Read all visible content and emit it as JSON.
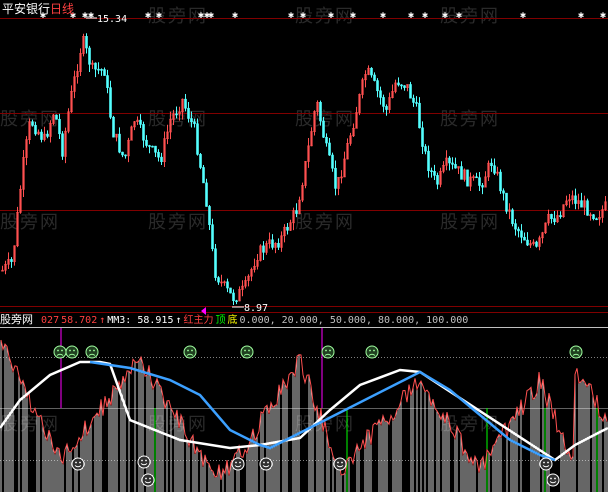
{
  "window": {
    "stock_name": "平安银行",
    "period_label": "日线"
  },
  "price_panel": {
    "high_label": "15.34",
    "low_label": "8.97"
  },
  "indicator_panel": {
    "name": "股旁网",
    "values": [
      {
        "key": "v1",
        "text": "027",
        "color": "#ff4040"
      },
      {
        "key": "v2",
        "text": "58.702",
        "color": "#ff4040"
      },
      {
        "key": "v2_arrow",
        "text": "↑",
        "color": "#ff4040"
      },
      {
        "key": "mm3",
        "text": "MM3: 58.915",
        "color": "#ffffff"
      },
      {
        "key": "mm3_arrow",
        "text": "↑",
        "color": "#ffffff"
      },
      {
        "key": "main",
        "text": "红主力",
        "color": "#ff4040"
      },
      {
        "key": "top",
        "text": "顶",
        "color": "#00ff00"
      },
      {
        "key": "bottom",
        "text": "底",
        "color": "#ffff00"
      },
      {
        "key": "levels",
        "text": "0.000, 20.000, 50.000, 80.000, 100.000",
        "color": "#c0c0c0"
      }
    ]
  },
  "watermark": "股旁网",
  "colors": {
    "up": "#ff5050",
    "down": "#54ffff",
    "grid": "#800000",
    "ma_white": "#ffffff",
    "ma_blue": "#3ca0ff",
    "signal_green": "#00ff00",
    "signal_magenta": "#ff00ff"
  }
}
